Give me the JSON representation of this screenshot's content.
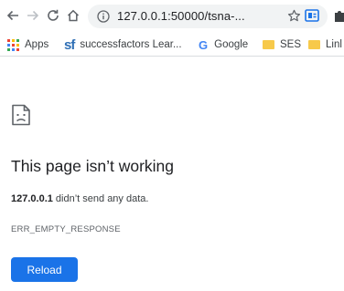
{
  "browser": {
    "url": "127.0.0.1:50000/tsna-...",
    "bookmarks": [
      {
        "label": "Apps",
        "icon": "apps-grid-icon"
      },
      {
        "label": "successfactors Lear...",
        "icon": "successfactors-icon"
      },
      {
        "label": "Google",
        "icon": "google-icon"
      },
      {
        "label": "SES",
        "icon": "folder-icon"
      },
      {
        "label": "Linl",
        "icon": "folder-icon"
      }
    ],
    "sf_logo": "sf",
    "google_logo": "G"
  },
  "error_page": {
    "title": "This page isn’t working",
    "host": "127.0.0.1",
    "summary_rest": " didn’t send any data.",
    "error_code": "ERR_EMPTY_RESPONSE",
    "reload_label": "Reload"
  },
  "colors": {
    "accent": "#1a73e8",
    "folder": "#f7c94a",
    "omnibox_bg": "#f1f3f4"
  }
}
